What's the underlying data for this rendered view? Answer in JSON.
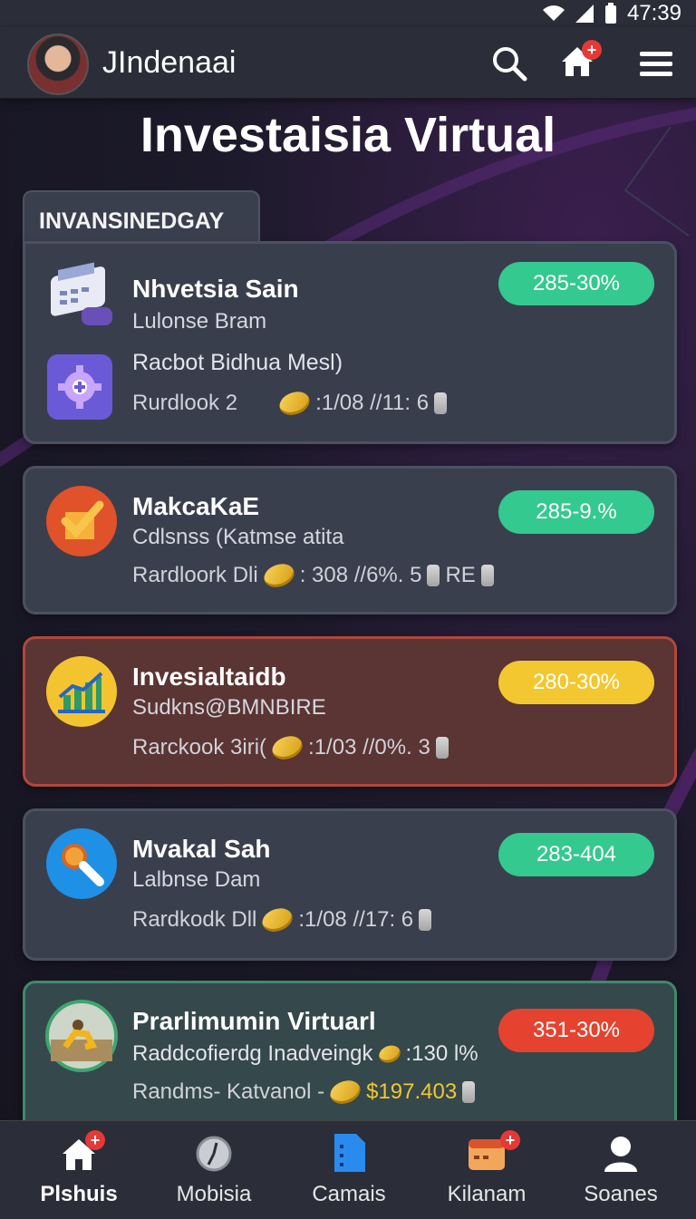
{
  "status_bar": {
    "time": "47:39"
  },
  "app_bar": {
    "title": "JIndenaai",
    "notification_badge": "+"
  },
  "page_title": "Investaisia Virtual",
  "section_label": "INVANSINEDGAY",
  "cards": [
    {
      "title": "Nhvetsia Sain",
      "subtitle": "Lulonse Bram",
      "line": "Racbot Bidhua Mesl)",
      "meta_label": "Rurdlook 2",
      "meta_value": ":1/08 //11: 6",
      "pill": "285-30%",
      "pill_color": "#33c98f",
      "icon": "calculator-icon"
    },
    {
      "title": "MakcaKaE",
      "subtitle": "Cdlsnss (Katmse atita",
      "meta_label": "Rardloork Dli",
      "meta_value": ": 308 //6%. 5",
      "meta_extra": "RE",
      "pill": "285-9.%",
      "pill_color": "#33c98f",
      "icon": "check-icon"
    },
    {
      "title": "Invesialtaidb",
      "subtitle": "Sudkns@BMNBIRE",
      "meta_label": "Rarckook 3iri(",
      "meta_value": ":1/03 //0%. 3",
      "pill": "280-30%",
      "pill_color": "#f2c730",
      "icon": "bar-chart-icon"
    },
    {
      "title": "Mvakal Sah",
      "subtitle": "Lalbnse Dam",
      "meta_label": "Rardkodk Dll",
      "meta_value": ":1/08 //17: 6",
      "pill": "283-404",
      "pill_color": "#33c98f",
      "icon": "magnifier-icon"
    },
    {
      "title": "Prarlimumin Virtuarl",
      "subtitle": "Raddcofierdg Inadveingk",
      "subtitle_value": ":130 l%",
      "meta_label": "Randms- Katvanol -",
      "meta_value": "$197.403",
      "pill": "351-30%",
      "pill_color": "#e5432f",
      "icon": "athlete-avatar-icon"
    }
  ],
  "bottom_nav": [
    {
      "label": "Plshuis",
      "icon": "home-icon",
      "active": true,
      "badge": "+"
    },
    {
      "label": "Mobisia",
      "icon": "clock-icon",
      "active": false
    },
    {
      "label": "Camais",
      "icon": "document-icon",
      "active": false
    },
    {
      "label": "Kilanam",
      "icon": "wallet-icon",
      "active": false,
      "badge": "+"
    },
    {
      "label": "Soanes",
      "icon": "profile-icon",
      "active": false
    }
  ]
}
